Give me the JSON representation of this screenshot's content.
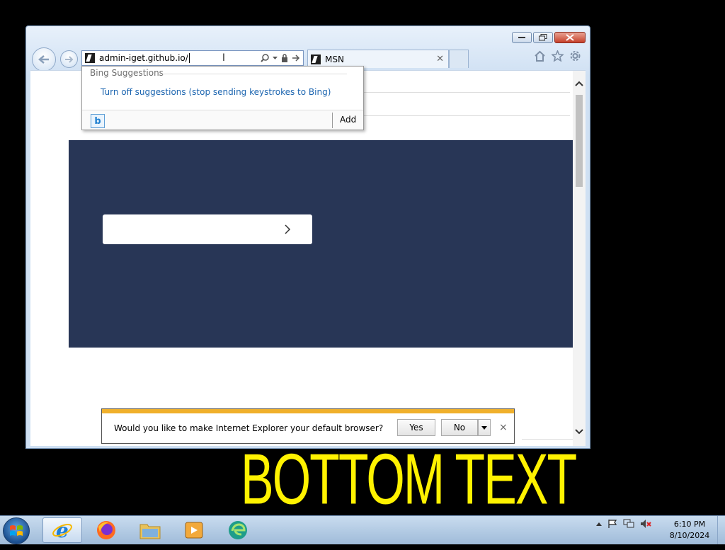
{
  "browser": {
    "address": "admin-iget.github.io/",
    "tab_title": "MSN"
  },
  "suggestions": {
    "heading": "Bing Suggestions",
    "turn_off": "Turn off suggestions (stop sending keystrokes to Bing)",
    "add": "Add"
  },
  "notification": {
    "text": "Would you like to make Internet Explorer your default browser?",
    "yes": "Yes",
    "no": "No",
    "close": "×"
  },
  "meme": {
    "caption": "BOTTOM TEXT"
  },
  "taskbar": {
    "time": "6:10 PM",
    "date": "8/10/2024"
  },
  "colors": {
    "page_panel": "#283656",
    "meme_text": "#fff200",
    "notify_stripe": "#f0b02b",
    "link": "#1c65b0"
  }
}
